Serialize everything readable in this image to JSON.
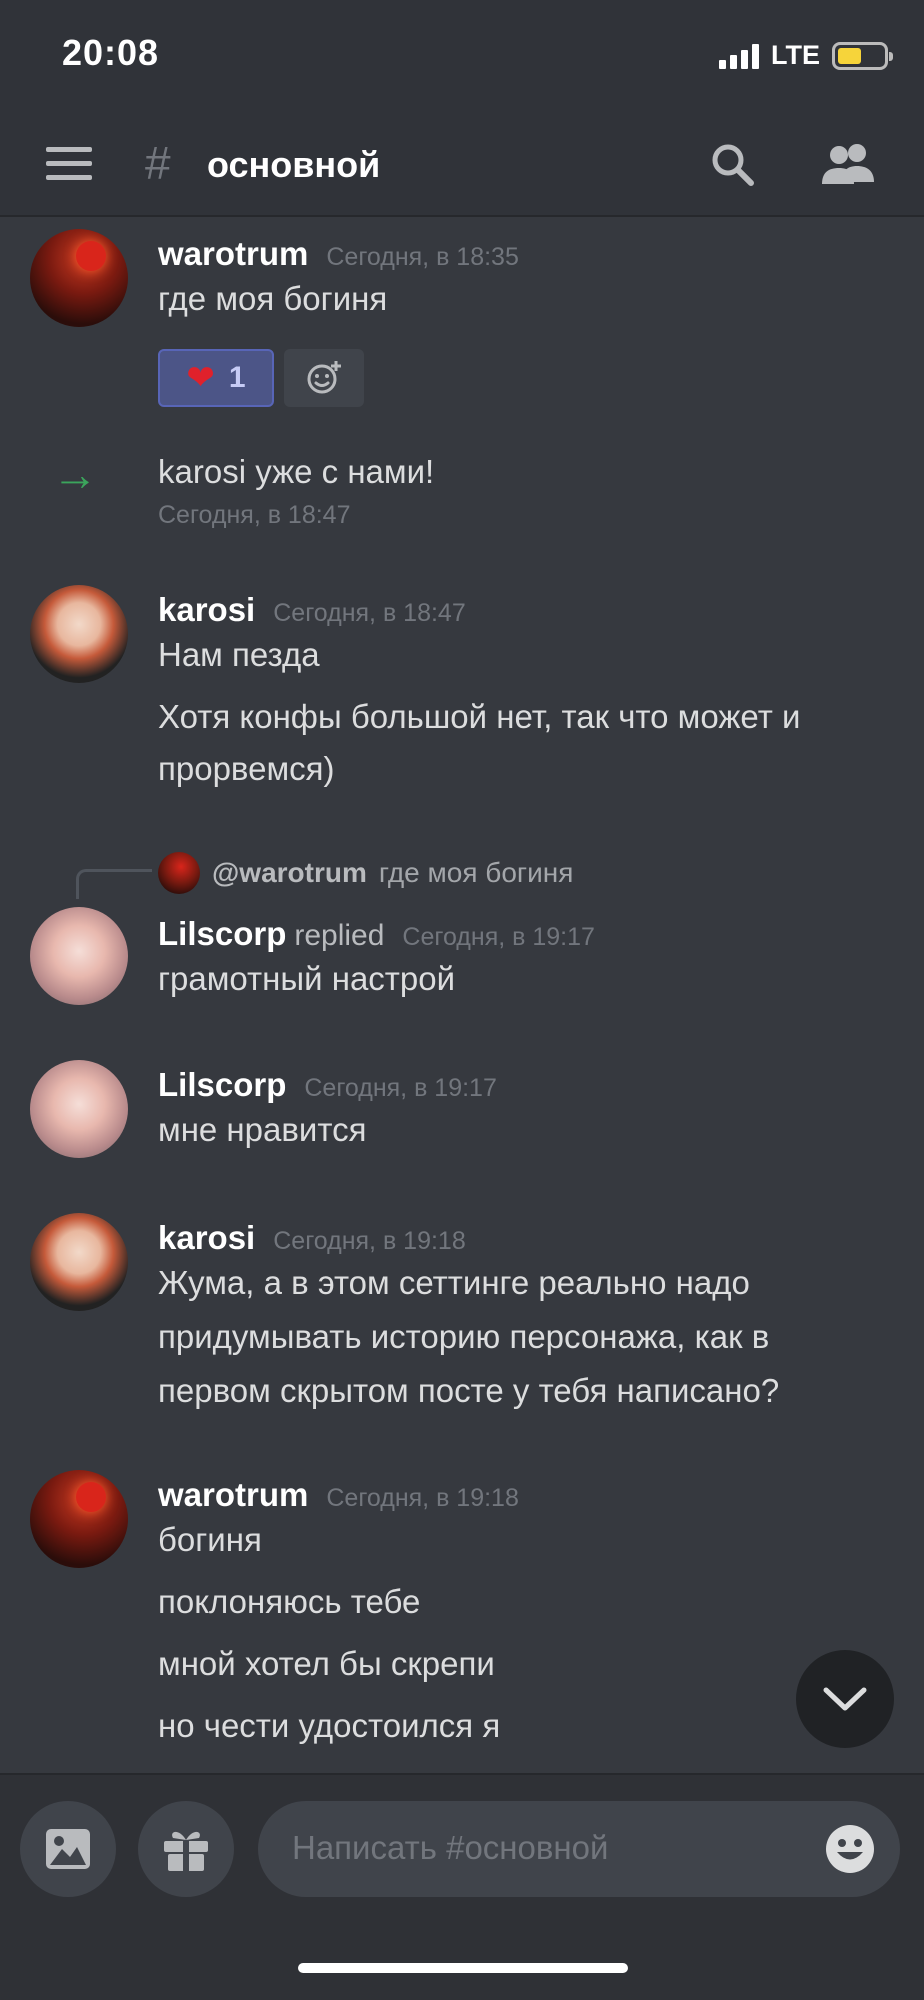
{
  "status_bar": {
    "time": "20:08",
    "network": "LTE",
    "battery_level": 0.45
  },
  "header": {
    "channel_hash": "#",
    "channel_name": "основной"
  },
  "messages": [
    {
      "type": "message",
      "author": "warotrum",
      "timestamp": "Сегодня, в 18:35",
      "lines": [
        "где моя богиня"
      ],
      "reactions": [
        {
          "emoji": "❤",
          "count": "1"
        }
      ]
    },
    {
      "type": "join",
      "text": "karosi уже с нами!",
      "timestamp": "Сегодня, в 18:47"
    },
    {
      "type": "message",
      "author": "karosi",
      "timestamp": "Сегодня, в 18:47",
      "lines": [
        "Нам пезда",
        "Хотя конфы большой нет, так что может и",
        "прорвемся)"
      ]
    },
    {
      "type": "reply",
      "reply_to_author": "@warotrum",
      "reply_to_text": "где моя богиня",
      "author": "Lilscorp",
      "replied_label": "replied",
      "timestamp": "Сегодня, в 19:17",
      "lines": [
        "грамотный настрой"
      ]
    },
    {
      "type": "message",
      "author": "Lilscorp",
      "timestamp": "Сегодня, в 19:17",
      "lines": [
        "мне нравится"
      ]
    },
    {
      "type": "message",
      "author": "karosi",
      "timestamp": "Сегодня, в 19:18",
      "lines": [
        "Жума, а в этом сеттинге реально надо",
        "придумывать историю персонажа, как в",
        "первом скрытом посте у тебя написано?"
      ]
    },
    {
      "type": "message",
      "author": "warotrum",
      "timestamp": "Сегодня, в 19:18",
      "lines": [
        "богиня",
        "поклоняюсь тебе",
        "мной хотел бы скрепи",
        "но чести удостоился я"
      ]
    }
  ],
  "composer": {
    "placeholder": "Написать #основной"
  },
  "icons": [
    "hamburger-menu-icon",
    "search-icon",
    "members-icon",
    "add-reaction-icon",
    "scroll-down-icon",
    "image-icon",
    "gift-icon",
    "emoji-icon"
  ],
  "colors": {
    "background": "#36393f",
    "header": "#303339",
    "join_arrow": "#3ba55c",
    "reaction_bg": "#4c5587",
    "battery": "#f6d43a"
  }
}
